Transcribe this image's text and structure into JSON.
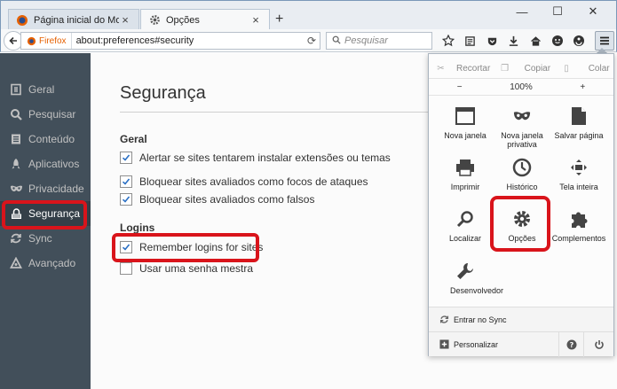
{
  "tabs": [
    {
      "title": "Página inicial do Mozilla F...",
      "state": "inactive"
    },
    {
      "title": "Opções",
      "state": "active"
    }
  ],
  "nav": {
    "identity_label": "Firefox",
    "url": "about:preferences#security",
    "search_placeholder": "Pesquisar"
  },
  "sidebar": {
    "items": [
      {
        "label": "Geral",
        "icon": "general-icon"
      },
      {
        "label": "Pesquisar",
        "icon": "search-icon"
      },
      {
        "label": "Conteúdo",
        "icon": "content-icon"
      },
      {
        "label": "Aplicativos",
        "icon": "applications-icon"
      },
      {
        "label": "Privacidade",
        "icon": "privacy-mask-icon"
      },
      {
        "label": "Segurança",
        "icon": "security-icon",
        "selected": true
      },
      {
        "label": "Sync",
        "icon": "sync-icon"
      },
      {
        "label": "Avançado",
        "icon": "advanced-icon"
      }
    ]
  },
  "main": {
    "title": "Segurança",
    "general_label": "Geral",
    "general_options": [
      {
        "label": "Alertar se sites tentarem instalar extensões ou temas",
        "checked": true
      },
      {
        "label": "Bloquear sites avaliados como focos de ataques",
        "checked": true
      },
      {
        "label": "Bloquear sites avaliados como falsos",
        "checked": true
      }
    ],
    "logins_label": "Logins",
    "logins_options": [
      {
        "label": "Remember logins for sites",
        "checked": true
      },
      {
        "label": "Usar uma senha mestra",
        "checked": false
      }
    ]
  },
  "menu": {
    "edit": {
      "cut": "Recortar",
      "copy": "Copiar",
      "paste": "Colar"
    },
    "zoom": {
      "minus": "−",
      "level": "100%",
      "plus": "+"
    },
    "items": [
      {
        "label": "Nova janela",
        "icon": "new-window-icon"
      },
      {
        "label": "Nova janela privativa",
        "icon": "private-window-icon"
      },
      {
        "label": "Salvar página",
        "icon": "save-page-icon"
      },
      {
        "label": "Imprimir",
        "icon": "print-icon"
      },
      {
        "label": "Histórico",
        "icon": "history-icon"
      },
      {
        "label": "Tela inteira",
        "icon": "fullscreen-icon"
      },
      {
        "label": "Localizar",
        "icon": "find-icon"
      },
      {
        "label": "Opções",
        "icon": "options-gear-icon"
      },
      {
        "label": "Complementos",
        "icon": "addons-icon"
      },
      {
        "label": "Desenvolvedor",
        "icon": "developer-wrench-icon"
      }
    ],
    "sync_label": "Entrar no Sync",
    "customize_label": "Personalizar"
  },
  "colors": {
    "highlight": "#d9141b",
    "sidebar_bg": "#424f5a",
    "firefox_orange": "#e66000"
  }
}
